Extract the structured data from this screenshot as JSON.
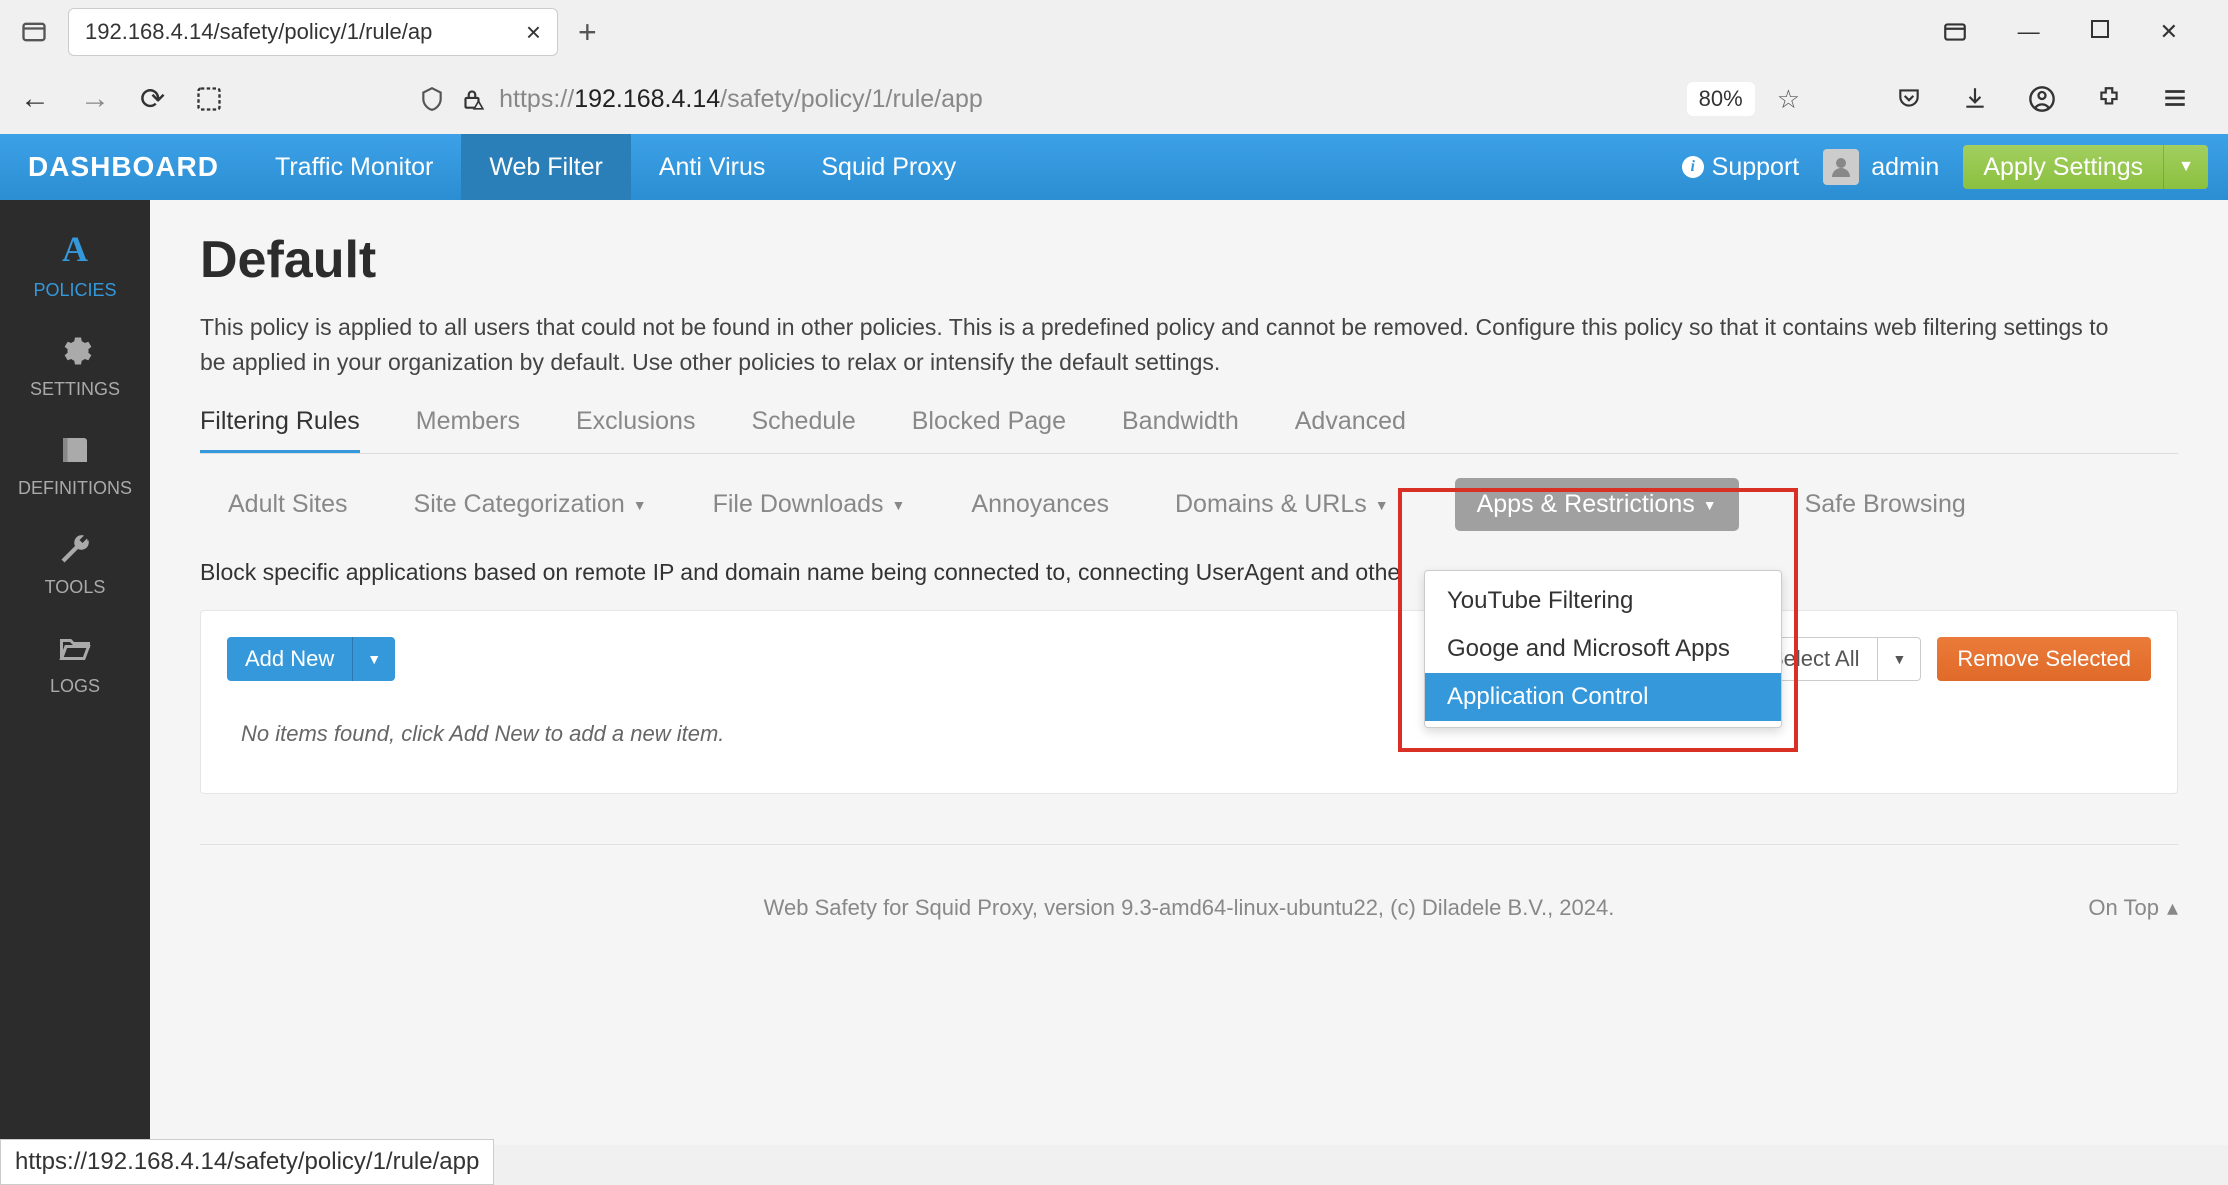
{
  "browser": {
    "tab_title": "192.168.4.14/safety/policy/1/rule/ap",
    "url_display_prefix": "https://",
    "url_host": "192.168.4.14",
    "url_path": "/safety/policy/1/rule/app",
    "zoom": "80%",
    "status_bar": "https://192.168.4.14/safety/policy/1/rule/app"
  },
  "topnav": {
    "brand": "DASHBOARD",
    "items": [
      "Traffic Monitor",
      "Web Filter",
      "Anti Virus",
      "Squid Proxy"
    ],
    "active_index": 1,
    "support": "Support",
    "user": "admin",
    "apply": "Apply Settings"
  },
  "sidebar": {
    "items": [
      {
        "label": "POLICIES",
        "icon": "A"
      },
      {
        "label": "SETTINGS",
        "icon": "gear"
      },
      {
        "label": "DEFINITIONS",
        "icon": "book"
      },
      {
        "label": "TOOLS",
        "icon": "wrench"
      },
      {
        "label": "LOGS",
        "icon": "folder"
      }
    ],
    "active_index": 0
  },
  "page": {
    "title": "Default",
    "description": "This policy is applied to all users that could not be found in other policies. This is a predefined policy and cannot be removed. Configure this policy so that it contains web filtering settings to be applied in your organization by default. Use other policies to relax or intensify the default settings.",
    "tabs": [
      "Filtering Rules",
      "Members",
      "Exclusions",
      "Schedule",
      "Blocked Page",
      "Bandwidth",
      "Advanced"
    ],
    "tabs_active_index": 0,
    "subtabs": [
      {
        "label": "Adult Sites",
        "dropdown": false
      },
      {
        "label": "Site Categorization",
        "dropdown": true
      },
      {
        "label": "File Downloads",
        "dropdown": true
      },
      {
        "label": "Annoyances",
        "dropdown": false
      },
      {
        "label": "Domains & URLs",
        "dropdown": true
      },
      {
        "label": "Apps & Restrictions",
        "dropdown": true,
        "highlight": true
      },
      {
        "label": "Safe Browsing",
        "dropdown": false
      }
    ],
    "dropdown_options": [
      "YouTube Filtering",
      "Googe and Microsoft Apps",
      "Application Control"
    ],
    "dropdown_highlight_index": 2,
    "helper_text": "Block specific applications based on remote IP and domain name being connected to, connecting UserAgent and othe",
    "add_new": "Add New",
    "select_all": "Select All",
    "remove_selected": "Remove Selected",
    "empty_message": "No items found, click Add New to add a new item.",
    "footer": "Web Safety for Squid Proxy, version 9.3-amd64-linux-ubuntu22, (c) Diladele B.V., 2024.",
    "on_top": "On Top"
  }
}
